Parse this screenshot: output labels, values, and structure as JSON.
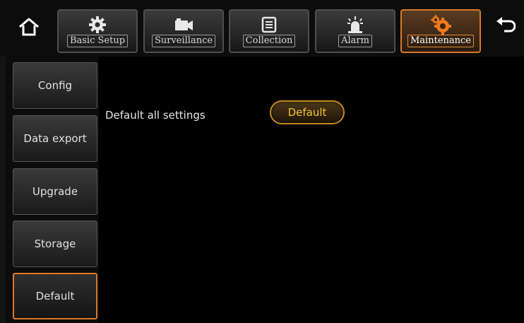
{
  "tabs": [
    {
      "label": "Basic Setup",
      "icon": "gear-icon",
      "active": false
    },
    {
      "label": "Surveillance",
      "icon": "camera-icon",
      "active": false
    },
    {
      "label": "Collection",
      "icon": "document-icon",
      "active": false
    },
    {
      "label": "Alarm",
      "icon": "alarm-light-icon",
      "active": false
    },
    {
      "label": "Maintenance",
      "icon": "maintenance-gears-icon",
      "active": true
    }
  ],
  "sidebar": {
    "items": [
      {
        "label": "Config",
        "active": false
      },
      {
        "label": "Data export",
        "active": false
      },
      {
        "label": "Upgrade",
        "active": false
      },
      {
        "label": "Storage",
        "active": false
      },
      {
        "label": "Default",
        "active": true
      }
    ]
  },
  "main": {
    "setting_label": "Default all settings",
    "default_button": "Default"
  },
  "colors": {
    "accent": "#d9782a",
    "button_text": "#f2c33a",
    "background": "#000000"
  }
}
